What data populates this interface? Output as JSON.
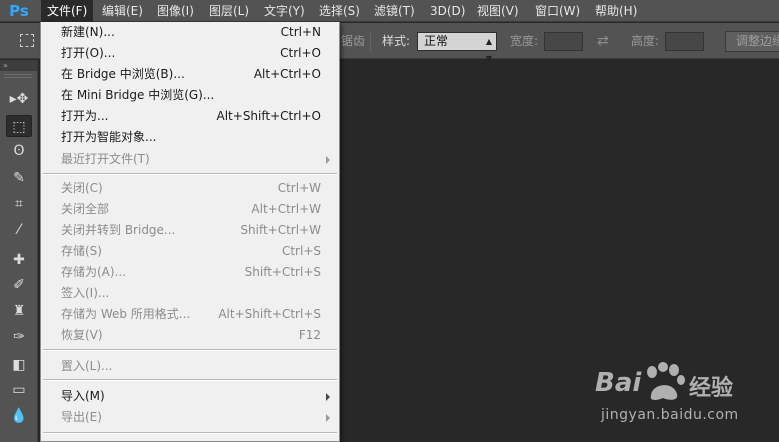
{
  "app": {
    "logo": "Ps"
  },
  "menubar": {
    "items": [
      {
        "label": "文件(F)"
      },
      {
        "label": "编辑(E)"
      },
      {
        "label": "图像(I)"
      },
      {
        "label": "图层(L)"
      },
      {
        "label": "文字(Y)"
      },
      {
        "label": "选择(S)"
      },
      {
        "label": "滤镜(T)"
      },
      {
        "label": "3D(D)"
      },
      {
        "label": "视图(V)"
      },
      {
        "label": "窗口(W)"
      },
      {
        "label": "帮助(H)"
      }
    ]
  },
  "options": {
    "partial_label": "锯齿",
    "style_label": "样式:",
    "style_value": "正常",
    "width_label": "宽度:",
    "height_label": "高度:",
    "refine_button": "调整边缘"
  },
  "file_menu": {
    "items": [
      {
        "label": "新建(N)...",
        "shortcut": "Ctrl+N",
        "enabled": true
      },
      {
        "label": "打开(O)...",
        "shortcut": "Ctrl+O",
        "enabled": true
      },
      {
        "label": "在 Bridge 中浏览(B)...",
        "shortcut": "Alt+Ctrl+O",
        "enabled": true
      },
      {
        "label": "在 Mini Bridge 中浏览(G)...",
        "shortcut": "",
        "enabled": true
      },
      {
        "label": "打开为...",
        "shortcut": "Alt+Shift+Ctrl+O",
        "enabled": true
      },
      {
        "label": "打开为智能对象...",
        "shortcut": "",
        "enabled": true
      },
      {
        "label": "最近打开文件(T)",
        "shortcut": "",
        "enabled": false,
        "submenu": true
      },
      {
        "label": "关闭(C)",
        "shortcut": "Ctrl+W",
        "enabled": false
      },
      {
        "label": "关闭全部",
        "shortcut": "Alt+Ctrl+W",
        "enabled": false
      },
      {
        "label": "关闭并转到 Bridge...",
        "shortcut": "Shift+Ctrl+W",
        "enabled": false
      },
      {
        "label": "存储(S)",
        "shortcut": "Ctrl+S",
        "enabled": false
      },
      {
        "label": "存储为(A)...",
        "shortcut": "Shift+Ctrl+S",
        "enabled": false
      },
      {
        "label": "签入(I)...",
        "shortcut": "",
        "enabled": false
      },
      {
        "label": "存储为 Web 所用格式...",
        "shortcut": "Alt+Shift+Ctrl+S",
        "enabled": false
      },
      {
        "label": "恢复(V)",
        "shortcut": "F12",
        "enabled": false
      },
      {
        "label": "置入(L)...",
        "shortcut": "",
        "enabled": false
      },
      {
        "label": "导入(M)",
        "shortcut": "",
        "enabled": true,
        "submenu": true
      },
      {
        "label": "导出(E)",
        "shortcut": "",
        "enabled": false,
        "submenu": true
      }
    ]
  },
  "toolbox": {
    "header": "»",
    "tools": [
      {
        "icon": "move-tool-icon",
        "glyph": "▸✥"
      },
      {
        "icon": "rectangular-marquee-tool-icon",
        "glyph": "⬚"
      },
      {
        "icon": "lasso-tool-icon",
        "glyph": "ʘ"
      },
      {
        "icon": "quick-selection-tool-icon",
        "glyph": "✎"
      },
      {
        "icon": "crop-tool-icon",
        "glyph": "⌗"
      },
      {
        "icon": "eyedropper-tool-icon",
        "glyph": "⁄"
      },
      {
        "icon": "spot-healing-brush-tool-icon",
        "glyph": "✚"
      },
      {
        "icon": "brush-tool-icon",
        "glyph": "✐"
      },
      {
        "icon": "clone-stamp-tool-icon",
        "glyph": "♜"
      },
      {
        "icon": "history-brush-tool-icon",
        "glyph": "✑"
      },
      {
        "icon": "eraser-tool-icon",
        "glyph": "◧"
      },
      {
        "icon": "gradient-tool-icon",
        "glyph": "▭"
      },
      {
        "icon": "blur-tool-icon",
        "glyph": "💧"
      }
    ]
  },
  "watermark": {
    "brand_a": "Bai",
    "brand_b": "经验",
    "url": "jingyan.baidu.com"
  },
  "colors": {
    "menu_bg": "#535353",
    "canvas_bg": "#282828",
    "dropdown_bg": "#f0f0f0",
    "disabled_text": "#8c8c8c"
  }
}
